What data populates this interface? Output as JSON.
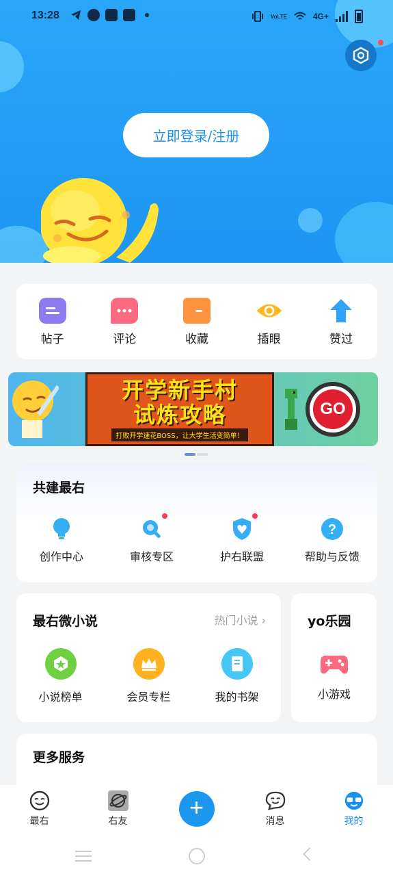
{
  "status_bar": {
    "time": "13:28",
    "network": "4G+",
    "volte": "VoLTE"
  },
  "header": {
    "login_button": "立即登录/注册",
    "settings_icon": "settings-hex-icon",
    "colors": {
      "bg": "#2aa6f8",
      "button_text": "#1c8fe8"
    }
  },
  "quick_actions": [
    {
      "label": "帖子",
      "icon": "post-icon",
      "color": "#8d7cf0"
    },
    {
      "label": "评论",
      "icon": "comment-icon",
      "color": "#fb6a80"
    },
    {
      "label": "收藏",
      "icon": "folder-icon",
      "color": "#ff9340"
    },
    {
      "label": "插眼",
      "icon": "eye-icon",
      "color": "#ffb71e"
    },
    {
      "label": "赞过",
      "icon": "thumb-up-icon",
      "color": "#2fa3f5"
    }
  ],
  "banner": {
    "title_line1": "开学新手村",
    "title_line2": "试炼攻略",
    "subtitle": "打败开学速花BOSS，让大学生活变简单！",
    "go_label": "GO"
  },
  "build_section": {
    "title": "共建最右",
    "items": [
      {
        "label": "创作中心",
        "icon": "lightbulb-icon",
        "badge": false
      },
      {
        "label": "审核专区",
        "icon": "magnifier-icon",
        "badge": true
      },
      {
        "label": "护右联盟",
        "icon": "shield-heart-icon",
        "badge": true
      },
      {
        "label": "帮助与反馈",
        "icon": "help-icon",
        "badge": false
      }
    ]
  },
  "novel_section": {
    "title": "最右微小说",
    "more_label": "热门小说",
    "items": [
      {
        "label": "小说榜单",
        "icon": "ranking-icon",
        "color": "#6fd042"
      },
      {
        "label": "会员专栏",
        "icon": "crown-icon",
        "color": "#ffb21e"
      },
      {
        "label": "我的书架",
        "icon": "book-icon",
        "color": "#45c7f5"
      }
    ]
  },
  "yo_section": {
    "title": "yo乐园",
    "item_label": "小游戏",
    "icon": "gamepad-icon"
  },
  "more_section": {
    "title": "更多服务"
  },
  "tabbar": {
    "tabs": [
      {
        "label": "最右",
        "icon": "zuiyou-face-icon"
      },
      {
        "label": "右友",
        "icon": "planet-icon"
      },
      {
        "label": "",
        "icon": "plus-icon"
      },
      {
        "label": "消息",
        "icon": "message-face-icon"
      },
      {
        "label": "我的",
        "icon": "profile-face-icon"
      }
    ],
    "active_index": 4,
    "accent": "#1c90ef"
  }
}
